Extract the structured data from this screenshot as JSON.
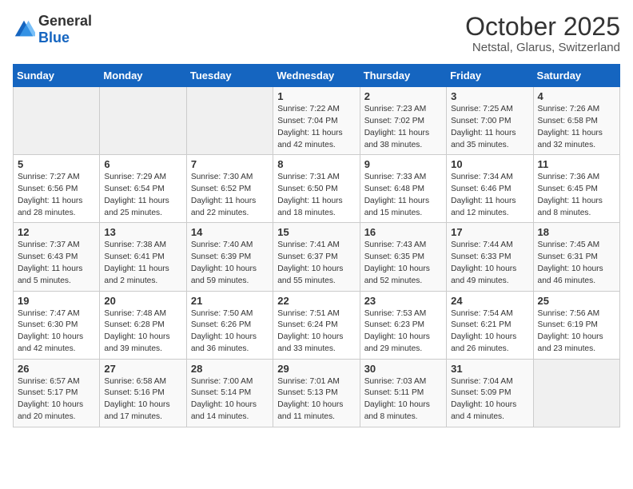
{
  "header": {
    "logo_general": "General",
    "logo_blue": "Blue",
    "month_year": "October 2025",
    "location": "Netstal, Glarus, Switzerland"
  },
  "days_of_week": [
    "Sunday",
    "Monday",
    "Tuesday",
    "Wednesday",
    "Thursday",
    "Friday",
    "Saturday"
  ],
  "weeks": [
    [
      {
        "day": "",
        "content": ""
      },
      {
        "day": "",
        "content": ""
      },
      {
        "day": "",
        "content": ""
      },
      {
        "day": "1",
        "content": "Sunrise: 7:22 AM\nSunset: 7:04 PM\nDaylight: 11 hours\nand 42 minutes."
      },
      {
        "day": "2",
        "content": "Sunrise: 7:23 AM\nSunset: 7:02 PM\nDaylight: 11 hours\nand 38 minutes."
      },
      {
        "day": "3",
        "content": "Sunrise: 7:25 AM\nSunset: 7:00 PM\nDaylight: 11 hours\nand 35 minutes."
      },
      {
        "day": "4",
        "content": "Sunrise: 7:26 AM\nSunset: 6:58 PM\nDaylight: 11 hours\nand 32 minutes."
      }
    ],
    [
      {
        "day": "5",
        "content": "Sunrise: 7:27 AM\nSunset: 6:56 PM\nDaylight: 11 hours\nand 28 minutes."
      },
      {
        "day": "6",
        "content": "Sunrise: 7:29 AM\nSunset: 6:54 PM\nDaylight: 11 hours\nand 25 minutes."
      },
      {
        "day": "7",
        "content": "Sunrise: 7:30 AM\nSunset: 6:52 PM\nDaylight: 11 hours\nand 22 minutes."
      },
      {
        "day": "8",
        "content": "Sunrise: 7:31 AM\nSunset: 6:50 PM\nDaylight: 11 hours\nand 18 minutes."
      },
      {
        "day": "9",
        "content": "Sunrise: 7:33 AM\nSunset: 6:48 PM\nDaylight: 11 hours\nand 15 minutes."
      },
      {
        "day": "10",
        "content": "Sunrise: 7:34 AM\nSunset: 6:46 PM\nDaylight: 11 hours\nand 12 minutes."
      },
      {
        "day": "11",
        "content": "Sunrise: 7:36 AM\nSunset: 6:45 PM\nDaylight: 11 hours\nand 8 minutes."
      }
    ],
    [
      {
        "day": "12",
        "content": "Sunrise: 7:37 AM\nSunset: 6:43 PM\nDaylight: 11 hours\nand 5 minutes."
      },
      {
        "day": "13",
        "content": "Sunrise: 7:38 AM\nSunset: 6:41 PM\nDaylight: 11 hours\nand 2 minutes."
      },
      {
        "day": "14",
        "content": "Sunrise: 7:40 AM\nSunset: 6:39 PM\nDaylight: 10 hours\nand 59 minutes."
      },
      {
        "day": "15",
        "content": "Sunrise: 7:41 AM\nSunset: 6:37 PM\nDaylight: 10 hours\nand 55 minutes."
      },
      {
        "day": "16",
        "content": "Sunrise: 7:43 AM\nSunset: 6:35 PM\nDaylight: 10 hours\nand 52 minutes."
      },
      {
        "day": "17",
        "content": "Sunrise: 7:44 AM\nSunset: 6:33 PM\nDaylight: 10 hours\nand 49 minutes."
      },
      {
        "day": "18",
        "content": "Sunrise: 7:45 AM\nSunset: 6:31 PM\nDaylight: 10 hours\nand 46 minutes."
      }
    ],
    [
      {
        "day": "19",
        "content": "Sunrise: 7:47 AM\nSunset: 6:30 PM\nDaylight: 10 hours\nand 42 minutes."
      },
      {
        "day": "20",
        "content": "Sunrise: 7:48 AM\nSunset: 6:28 PM\nDaylight: 10 hours\nand 39 minutes."
      },
      {
        "day": "21",
        "content": "Sunrise: 7:50 AM\nSunset: 6:26 PM\nDaylight: 10 hours\nand 36 minutes."
      },
      {
        "day": "22",
        "content": "Sunrise: 7:51 AM\nSunset: 6:24 PM\nDaylight: 10 hours\nand 33 minutes."
      },
      {
        "day": "23",
        "content": "Sunrise: 7:53 AM\nSunset: 6:23 PM\nDaylight: 10 hours\nand 29 minutes."
      },
      {
        "day": "24",
        "content": "Sunrise: 7:54 AM\nSunset: 6:21 PM\nDaylight: 10 hours\nand 26 minutes."
      },
      {
        "day": "25",
        "content": "Sunrise: 7:56 AM\nSunset: 6:19 PM\nDaylight: 10 hours\nand 23 minutes."
      }
    ],
    [
      {
        "day": "26",
        "content": "Sunrise: 6:57 AM\nSunset: 5:17 PM\nDaylight: 10 hours\nand 20 minutes."
      },
      {
        "day": "27",
        "content": "Sunrise: 6:58 AM\nSunset: 5:16 PM\nDaylight: 10 hours\nand 17 minutes."
      },
      {
        "day": "28",
        "content": "Sunrise: 7:00 AM\nSunset: 5:14 PM\nDaylight: 10 hours\nand 14 minutes."
      },
      {
        "day": "29",
        "content": "Sunrise: 7:01 AM\nSunset: 5:13 PM\nDaylight: 10 hours\nand 11 minutes."
      },
      {
        "day": "30",
        "content": "Sunrise: 7:03 AM\nSunset: 5:11 PM\nDaylight: 10 hours\nand 8 minutes."
      },
      {
        "day": "31",
        "content": "Sunrise: 7:04 AM\nSunset: 5:09 PM\nDaylight: 10 hours\nand 4 minutes."
      },
      {
        "day": "",
        "content": ""
      }
    ]
  ]
}
